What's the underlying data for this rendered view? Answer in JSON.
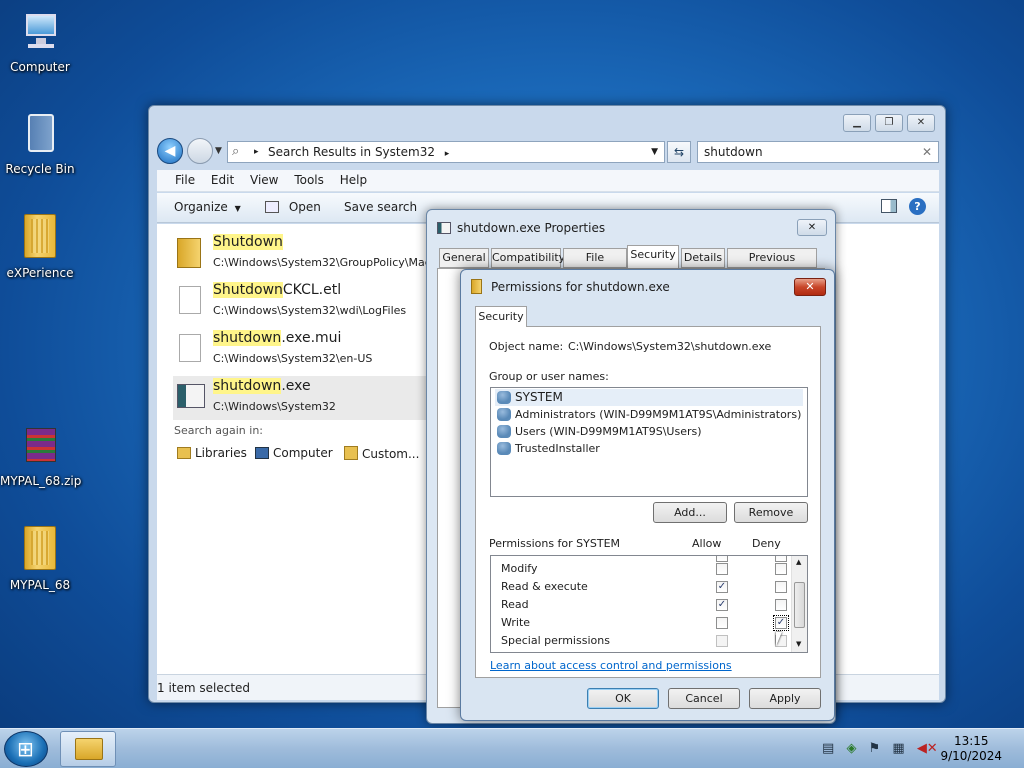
{
  "desktop": {
    "icons": [
      {
        "label": "Computer"
      },
      {
        "label": "Recycle Bin"
      },
      {
        "label": "eXPerience"
      },
      {
        "label": "MYPAL_68.zip"
      },
      {
        "label": "MYPAL_68"
      }
    ]
  },
  "explorer": {
    "address": "Search Results in System32",
    "search_value": "shutdown",
    "menu": [
      "File",
      "Edit",
      "View",
      "Tools",
      "Help"
    ],
    "toolbar": {
      "organize": "Organize",
      "open": "Open",
      "save_search": "Save search"
    },
    "results": [
      {
        "name_hl": "Shutdown",
        "name_rest": "",
        "path": "C:\\Windows\\System32\\GroupPolicy\\Mac"
      },
      {
        "name_hl": "Shutdown",
        "name_rest": "CKCL.etl",
        "path": "C:\\Windows\\System32\\wdi\\LogFiles"
      },
      {
        "name_hl": "shutdown",
        "name_rest": ".exe.mui",
        "path": "C:\\Windows\\System32\\en-US"
      },
      {
        "name_hl": "shutdown",
        "name_rest": ".exe",
        "path": "C:\\Windows\\System32"
      }
    ],
    "search_again": "Search again in:",
    "search_again_items": [
      "Libraries",
      "Computer",
      "Custom..."
    ],
    "status": "1 item selected"
  },
  "properties": {
    "title": "shutdown.exe Properties",
    "tabs": [
      "General",
      "Compatibility",
      "File Hashes",
      "Security",
      "Details",
      "Previous Versions"
    ],
    "active_tab": "Security"
  },
  "permissions": {
    "title": "Permissions for shutdown.exe",
    "tab": "Security",
    "object_label": "Object name:",
    "object_value": "C:\\Windows\\System32\\shutdown.exe",
    "group_label": "Group or user names:",
    "users": [
      "SYSTEM",
      "Administrators (WIN-D99M9M1AT9S\\Administrators)",
      "Users (WIN-D99M9M1AT9S\\Users)",
      "TrustedInstaller"
    ],
    "add_button": "Add...",
    "remove_button": "Remove",
    "perm_label": "Permissions for SYSTEM",
    "allow_label": "Allow",
    "deny_label": "Deny",
    "perms": [
      {
        "name": "Modify",
        "allow": false,
        "deny": false,
        "disabled": false
      },
      {
        "name": "Read & execute",
        "allow": true,
        "deny": false,
        "disabled": false
      },
      {
        "name": "Read",
        "allow": true,
        "deny": false,
        "disabled": false
      },
      {
        "name": "Write",
        "allow": false,
        "deny": true,
        "disabled": false
      },
      {
        "name": "Special permissions",
        "allow": false,
        "deny": false,
        "disabled": true
      }
    ],
    "link": "Learn about access control and permissions",
    "ok": "OK",
    "cancel": "Cancel",
    "apply": "Apply"
  },
  "taskbar": {
    "time": "13:15",
    "date": "9/10/2024"
  }
}
